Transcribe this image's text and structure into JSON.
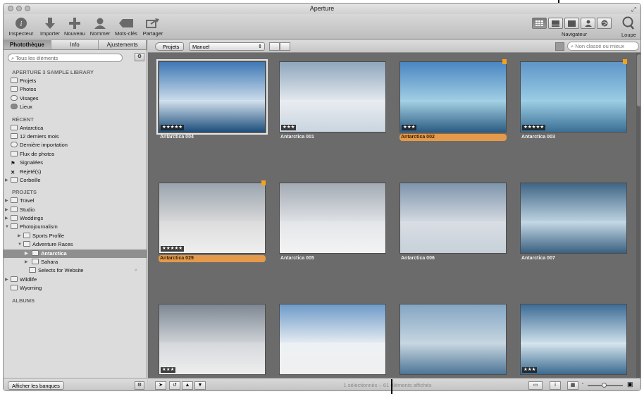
{
  "window": {
    "title": "Aperture"
  },
  "toolbar": {
    "buttons": [
      {
        "label": "Inspecteur",
        "icon": "info-icon"
      },
      {
        "label": "Importer",
        "icon": "import-arrow-icon"
      },
      {
        "label": "Nouveau",
        "icon": "plus-icon"
      },
      {
        "label": "Nommer",
        "icon": "person-icon"
      },
      {
        "label": "Mots-clés",
        "icon": "tag-icon"
      },
      {
        "label": "Partager",
        "icon": "share-icon"
      }
    ],
    "navigator_label": "Navigateur",
    "loupe_label": "Loupe"
  },
  "left_panel": {
    "tabs": [
      "Photothèque",
      "Info",
      "Ajustements"
    ],
    "search_placeholder": "Tous les éléments",
    "library_header": "APERTURE 3 SAMPLE LIBRARY",
    "library_items": [
      "Projets",
      "Photos",
      "Visages",
      "Lieux"
    ],
    "recent_header": "RÉCENT",
    "recent_items": [
      "Antarctica",
      "12 derniers mois",
      "Dernière importation",
      "Flux de photos",
      "Signalées",
      "Rejeté(s)",
      "Corbeille"
    ],
    "projects_header": "PROJETS",
    "project_items": [
      "Travel",
      "Studio",
      "Weddings",
      "Photojournalism",
      "Sports Profile",
      "Adventure Races",
      "Antarctica",
      "Sahara",
      "Selects for Website",
      "Wildlife",
      "Wyoming"
    ],
    "albums_header": "ALBUMS",
    "show_vaults_button": "Afficher les banques"
  },
  "browser_bar": {
    "projects_button": "Projets",
    "sort_value": "Manuel",
    "search_placeholder": "Non classé ou mieux"
  },
  "thumbnails": [
    {
      "name": "Antarctica 004",
      "stars": "★★★★★",
      "selected": true
    },
    {
      "name": "Antarctica 001",
      "stars": "★★★"
    },
    {
      "name": "Antarctica 002",
      "stars": "★★★",
      "highlighted": true,
      "flagged": true
    },
    {
      "name": "Antarctica 003",
      "stars": "★★★★★",
      "flagged": true
    },
    {
      "name": "Antarctica 029",
      "stars": "★★★★★",
      "highlighted": true,
      "flagged": true
    },
    {
      "name": "Antarctica 005",
      "stars": ""
    },
    {
      "name": "Antarctica 006",
      "stars": ""
    },
    {
      "name": "Antarctica 007",
      "stars": ""
    },
    {
      "name": "",
      "stars": "★★★"
    },
    {
      "name": "",
      "stars": ""
    },
    {
      "name": "",
      "stars": ""
    },
    {
      "name": "",
      "stars": "★★★"
    }
  ],
  "status": {
    "text": "1 sélectionnés – 61 éléments affichés"
  },
  "colors": {
    "browser_bg": "#6b6b6b",
    "highlight": "#e49a4a",
    "flag": "#f5a21c"
  }
}
